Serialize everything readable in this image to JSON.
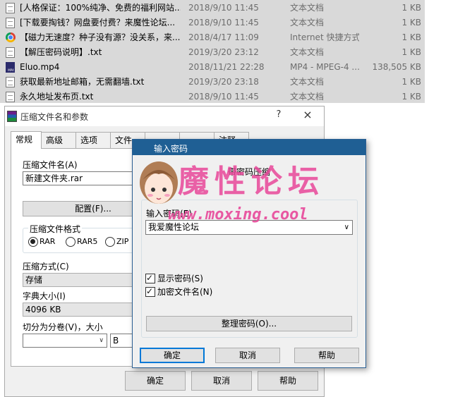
{
  "files": [
    {
      "name": "[人格保证：100%纯净、免费的福利网站...",
      "date": "2018/9/10 11:45",
      "type": "文本文档",
      "size": "1 KB",
      "icon": "txt"
    },
    {
      "name": "[下载要掏钱？网盘要付费？来魔性论坛...",
      "date": "2018/9/10 11:45",
      "type": "文本文档",
      "size": "1 KB",
      "icon": "txt"
    },
    {
      "name": "【磁力无速度？种子没有源？没关系，来...",
      "date": "2018/4/17 11:09",
      "type": "Internet 快捷方式",
      "size": "1 KB",
      "icon": "chrome"
    },
    {
      "name": "【解压密码说明】.txt",
      "date": "2019/3/20 23:12",
      "type": "文本文档",
      "size": "1 KB",
      "icon": "txt"
    },
    {
      "name": "Eluo.mp4",
      "date": "2018/11/21 22:28",
      "type": "MP4 - MPEG-4 ...",
      "size": "138,505 KB",
      "icon": "mp4"
    },
    {
      "name": "获取最新地址邮箱，无需翻墙.txt",
      "date": "2019/3/20 23:18",
      "type": "文本文档",
      "size": "1 KB",
      "icon": "txt"
    },
    {
      "name": "永久地址发布页.txt",
      "date": "2018/9/10 11:45",
      "type": "文本文档",
      "size": "1 KB",
      "icon": "txt"
    }
  ],
  "compress_dialog": {
    "title": "压缩文件名和参数",
    "help": "?",
    "close": "×",
    "tabs": [
      "常规",
      "高级",
      "选项",
      "文件",
      "",
      "",
      "注释"
    ],
    "archive_name_label": "压缩文件名(A)",
    "archive_name_value": "新建文件夹.rar",
    "config_button": "配置(F)...",
    "format_label": "压缩文件格式",
    "formats": [
      "RAR",
      "RAR5",
      "ZIP"
    ],
    "method_label": "压缩方式(C)",
    "method_value": "存储",
    "dict_label": "字典大小(I)",
    "dict_value": "4096 KB",
    "split_label": "切分为分卷(V)，大小",
    "split_unit": "B",
    "ok": "确定",
    "cancel": "取消",
    "help_button": "帮助"
  },
  "password_dialog": {
    "title": "输入密码",
    "heading": "带密码压缩",
    "enter_label": "输入密码(E)",
    "password_value": "我爱魔性论坛",
    "show_password": "显示密码(S)",
    "encrypt_names": "加密文件名(N)",
    "organize_button": "整理密码(O)...",
    "ok": "确定",
    "cancel": "取消",
    "help": "帮助"
  },
  "watermark": {
    "title": "魔性论坛",
    "url": "www.moxing.cool"
  },
  "colors": {
    "titlebar": "#1f5f94",
    "watermark": "#e8489a",
    "list_bg": "#d9d9d9"
  }
}
